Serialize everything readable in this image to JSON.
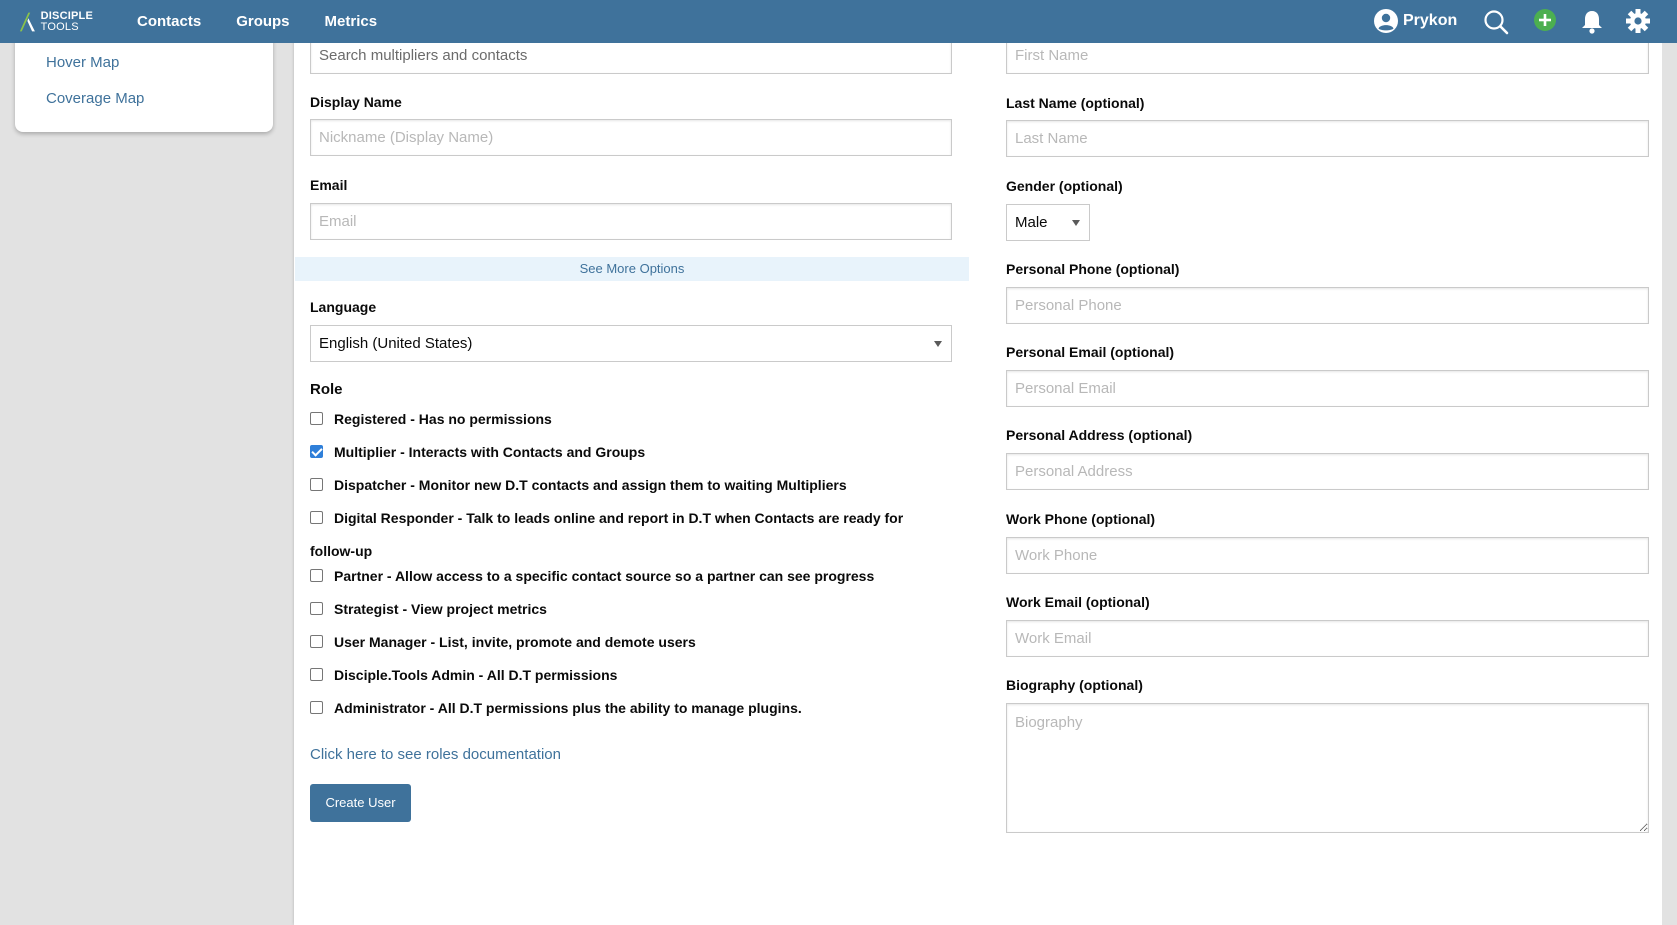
{
  "topbar": {
    "logo_line1": "DISCIPLE",
    "logo_line2": "TOOLS",
    "nav": [
      "Contacts",
      "Groups",
      "Metrics"
    ],
    "user_name": "Prykon",
    "bg_color": "#3f729b",
    "icons": [
      "user-avatar-icon",
      "search-icon",
      "add-circle-icon",
      "bell-icon",
      "gear-icon"
    ]
  },
  "sidebar": {
    "items": [
      {
        "label": "Hover Map"
      },
      {
        "label": "Coverage Map"
      }
    ]
  },
  "form_left": {
    "search_placeholder": "Search multipliers and contacts",
    "display_name_label": "Display Name",
    "display_name_placeholder": "Nickname (Display Name)",
    "email_label": "Email",
    "email_placeholder": "Email",
    "more_options": "See More Options",
    "language_label": "Language",
    "language_value": "English (United States)",
    "role_label": "Role",
    "roles": [
      {
        "label": "Registered - Has no permissions",
        "checked": false
      },
      {
        "label": "Multiplier - Interacts with Contacts and Groups",
        "checked": true
      },
      {
        "label": "Dispatcher - Monitor new D.T contacts and assign them to waiting Multipliers",
        "checked": false
      },
      {
        "label": "Digital Responder - Talk to leads online and report in D.T when Contacts are ready for",
        "checked": false,
        "wrap": "follow-up"
      },
      {
        "label": "Partner - Allow access to a specific contact source so a partner can see progress",
        "checked": false
      },
      {
        "label": "Strategist - View project metrics",
        "checked": false
      },
      {
        "label": "User Manager - List, invite, promote and demote users",
        "checked": false
      },
      {
        "label": "Disciple.Tools Admin - All D.T permissions",
        "checked": false
      },
      {
        "label": "Administrator - All D.T permissions plus the ability to manage plugins.",
        "checked": false
      }
    ],
    "doc_link": "Click here to see roles documentation",
    "create_button": "Create User"
  },
  "form_right": {
    "first_name_placeholder": "First Name",
    "last_name_label": "Last Name (optional)",
    "last_name_placeholder": "Last Name",
    "gender_label": "Gender (optional)",
    "gender_value": "Male",
    "personal_phone_label": "Personal Phone (optional)",
    "personal_phone_placeholder": "Personal Phone",
    "personal_email_label": "Personal Email (optional)",
    "personal_email_placeholder": "Personal Email",
    "personal_address_label": "Personal Address (optional)",
    "personal_address_placeholder": "Personal Address",
    "work_phone_label": "Work Phone (optional)",
    "work_phone_placeholder": "Work Phone",
    "work_email_label": "Work Email (optional)",
    "work_email_placeholder": "Work Email",
    "biography_label": "Biography (optional)",
    "biography_placeholder": "Biography"
  }
}
